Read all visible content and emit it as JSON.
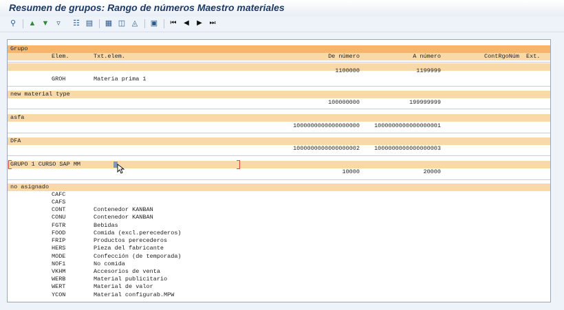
{
  "window": {
    "title": "Resumen de grupos: Rango de números Maestro materiales"
  },
  "toolbar": {
    "icons": [
      "details-icon",
      "sort-ascending-icon",
      "filter-icon",
      "filter-settings-icon",
      "export-icon",
      "print-icon",
      "layout-icon",
      "expand-icon",
      "collapse-icon",
      "info-icon",
      "first-page-icon",
      "previous-page-icon",
      "next-page-icon",
      "last-page-icon"
    ]
  },
  "table": {
    "header": {
      "group_label": "Grupo",
      "col_elem": "Elem.",
      "col_txt": "Txt.elem.",
      "col_from": "De número",
      "col_to": "A número",
      "col_contrg": "ContRgoNúm",
      "col_ext": "Ext."
    },
    "groups": [
      {
        "name": "",
        "from": "1100000",
        "to": "1199999",
        "elements": [
          {
            "code": "GROH",
            "text": "Materia prima 1"
          }
        ]
      },
      {
        "name": "new material type",
        "from": "100000000",
        "to": "199999999",
        "elements": []
      },
      {
        "name": "asfa",
        "from": "1000000000000000000",
        "to": "1000000000000000001",
        "elements": []
      },
      {
        "name": "DFA",
        "from": "1000000000000000002",
        "to": "1000000000000000003",
        "elements": []
      },
      {
        "name": "GRUPO 1 CURSO SAP MM",
        "from": "10000",
        "to": "20000",
        "elements": []
      }
    ],
    "unassigned": {
      "name": "no asignado",
      "elements": [
        {
          "code": "CAFC",
          "text": ""
        },
        {
          "code": "CAFS",
          "text": ""
        },
        {
          "code": "CONT",
          "text": "Contenedor KANBAN"
        },
        {
          "code": "CONU",
          "text": "Contenedor KANBAN"
        },
        {
          "code": "FGTR",
          "text": "Bebidas"
        },
        {
          "code": "FOOD",
          "text": "Comida (excl.perecederos)"
        },
        {
          "code": "FRIP",
          "text": "Productos perecederos"
        },
        {
          "code": "HERS",
          "text": "Pieza del fabricante"
        },
        {
          "code": "MODE",
          "text": "Confección (de temporada)"
        },
        {
          "code": "NOF1",
          "text": "No comida"
        },
        {
          "code": "VKHM",
          "text": "Accesorios de venta"
        },
        {
          "code": "WERB",
          "text": "Material publicitario"
        },
        {
          "code": "WERT",
          "text": "Material de valor"
        },
        {
          "code": "YCON",
          "text": "Material configurab.MPW"
        }
      ]
    }
  }
}
